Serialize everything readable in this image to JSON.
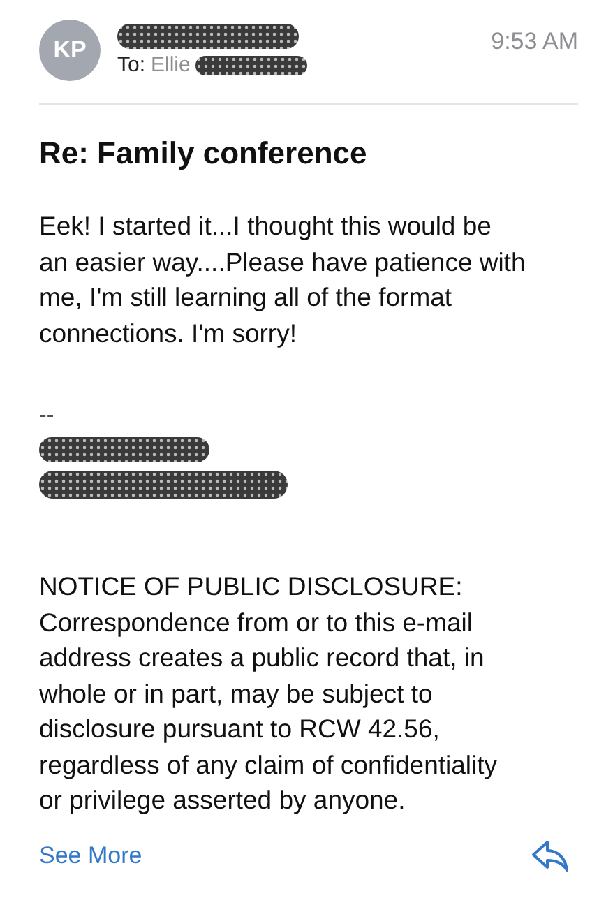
{
  "header": {
    "avatar_initials": "KP",
    "to_label": "To:",
    "to_name": "Ellie",
    "time": "9:53 AM"
  },
  "subject": "Re:  Family conference",
  "body": [
    [
      "Eek!  I started it...I thought this would be",
      "an easier way....Please have patience with",
      "me, I'm still learning all of the format",
      "connections. I'm sorry!"
    ]
  ],
  "signature": {
    "separator": "--"
  },
  "notice": [
    "NOTICE OF PUBLIC DISCLOSURE:",
    "Correspondence from or to this e-mail",
    "address creates a public record that, in",
    "whole or in part, may be subject to",
    "disclosure pursuant to RCW 42.56,",
    "regardless of any claim of confidentiality",
    "or privilege asserted by anyone."
  ],
  "footer": {
    "see_more": "See More"
  }
}
